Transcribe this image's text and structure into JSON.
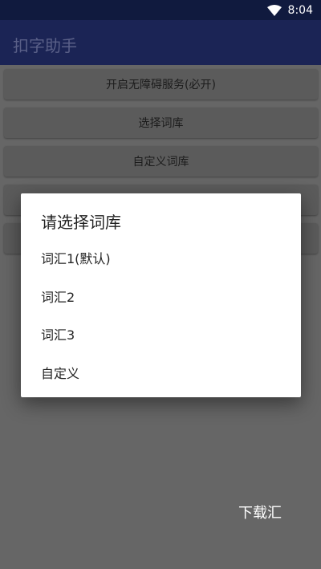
{
  "status": {
    "time": "8:04",
    "wifi_icon": "wifi-icon"
  },
  "app": {
    "title": "扣字助手"
  },
  "buttons": [
    {
      "label": "开启无障碍服务(必开)"
    },
    {
      "label": "选择词库"
    },
    {
      "label": "自定义词库"
    },
    {
      "label": ""
    },
    {
      "label": ""
    }
  ],
  "floating_text": "下载汇",
  "dialog": {
    "title": "请选择词库",
    "options": [
      {
        "label": "词汇1(默认)"
      },
      {
        "label": "词汇2"
      },
      {
        "label": "词汇3"
      },
      {
        "label": "自定义"
      }
    ]
  },
  "colors": {
    "status_bar": "#101a3e",
    "app_bar": "#1b2455",
    "scrim_background": "#666666",
    "dialog_background": "#ffffff"
  }
}
